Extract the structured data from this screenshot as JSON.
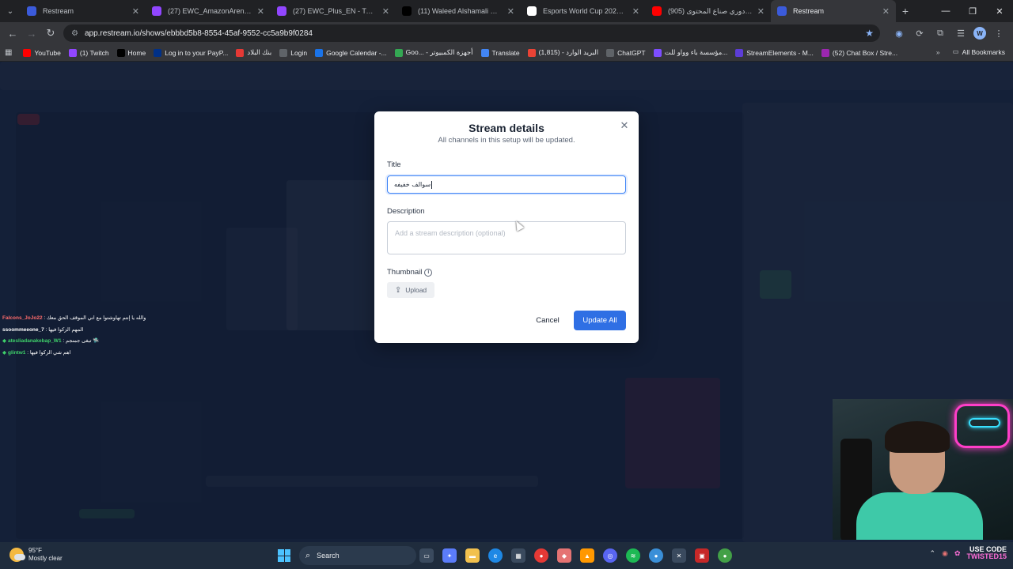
{
  "browser": {
    "tabs": [
      {
        "title": "Restream",
        "favicon": "restream-icon",
        "color": "#3b5bdb",
        "active": false
      },
      {
        "title": "(27) EWC_AmazonArena_EN - T",
        "favicon": "twitch-icon",
        "color": "#9146ff",
        "active": false
      },
      {
        "title": "(27) EWC_Plus_EN - Twitch",
        "favicon": "twitch-icon",
        "color": "#9146ff",
        "active": false
      },
      {
        "title": "(11) Waleed Alshamali 🧿 on X",
        "favicon": "x-icon",
        "color": "#000000",
        "active": false
      },
      {
        "title": "Esports World Cup 2025 featur",
        "favicon": "ewc-icon",
        "color": "#ffffff",
        "active": false
      },
      {
        "title": "(905) دوري صناع المحتوى - 🔊",
        "favicon": "youtube-icon",
        "color": "#ff0000",
        "active": false
      },
      {
        "title": "Restream",
        "favicon": "restream-icon",
        "color": "#3b5bdb",
        "active": true
      }
    ],
    "url": "app.restream.io/shows/ebbbd5b8-8554-45af-9552-cc5a9b9f0284",
    "bookmarks": [
      {
        "label": "YouTube",
        "icon": "youtube-icon",
        "color": "#ff0000"
      },
      {
        "label": "(1) Twitch",
        "icon": "twitch-icon",
        "color": "#9146ff"
      },
      {
        "label": "Home",
        "icon": "x-icon",
        "color": "#000000"
      },
      {
        "label": "Log in to your PayP...",
        "icon": "paypal-icon",
        "color": "#003087"
      },
      {
        "label": "بنك البلاد",
        "icon": "bank-icon",
        "color": "#e53935"
      },
      {
        "label": "Login",
        "icon": "globe-icon",
        "color": "#5f6368"
      },
      {
        "label": "Google Calendar -...",
        "icon": "calendar-icon",
        "color": "#1a73e8"
      },
      {
        "label": "Goo... - أجهزة الكمبيوتر",
        "icon": "google-icon",
        "color": "#34a853"
      },
      {
        "label": "Translate",
        "icon": "translate-icon",
        "color": "#4285f4"
      },
      {
        "label": "البريد الوارد - (1,815)",
        "icon": "gmail-icon",
        "color": "#ea4335"
      },
      {
        "label": "ChatGPT",
        "icon": "chatgpt-icon",
        "color": "#5f6368"
      },
      {
        "label": "مؤسسة باء وواو للت...",
        "icon": "org-icon",
        "color": "#7c4dff"
      },
      {
        "label": "StreamElements - M...",
        "icon": "streamelements-icon",
        "color": "#5c3dd6"
      },
      {
        "label": "(52) Chat Box / Stre...",
        "icon": "chatbox-icon",
        "color": "#9c27b0"
      }
    ],
    "all_bookmarks": "All Bookmarks"
  },
  "modal": {
    "title": "Stream details",
    "subtitle": "All channels in this setup will be updated.",
    "title_label": "Title",
    "title_value": "سوالف خفيفه",
    "description_label": "Description",
    "description_placeholder": "Add a stream description (optional)",
    "thumbnail_label": "Thumbnail",
    "upload_label": "Upload",
    "cancel_label": "Cancel",
    "update_label": "Update All"
  },
  "chat": [
    {
      "user": "Falcons_JoJo22",
      "text": ": والله يا إنتم تهاوشتوا مع اني الموقف الحق معك",
      "color": "#ff6b6b",
      "badge": ""
    },
    {
      "user": "ssoommeeone_7",
      "text": ": المهم الزكوا فيها",
      "color": "#ffffff",
      "badge": ""
    },
    {
      "user": "atesliadanakebap_W1",
      "text": ": تبغى جمنجم 🛸",
      "color": "#3fd16a",
      "badge": "◆"
    },
    {
      "user": "glintw1",
      "text": ": اهم شي الزكوا فيها",
      "color": "#3fd16a",
      "badge": "◆"
    }
  ],
  "taskbar": {
    "temp": "95°F",
    "weather": "Mostly clear",
    "search": "Search",
    "promo_line1": "USE CODE",
    "promo_line2": "TWISTED15"
  }
}
